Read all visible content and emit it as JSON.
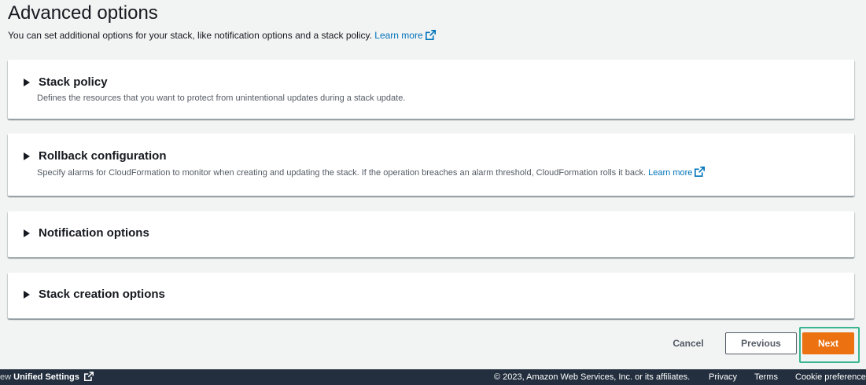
{
  "header": {
    "title": "Advanced options",
    "description": "You can set additional options for your stack, like notification options and a stack policy.",
    "learn_more": "Learn more"
  },
  "panels": [
    {
      "title": "Stack policy",
      "description": "Defines the resources that you want to protect from unintentional updates during a stack update."
    },
    {
      "title": "Rollback configuration",
      "description": "Specify alarms for CloudFormation to monitor when creating and updating the stack. If the operation breaches an alarm threshold, CloudFormation rolls it back.",
      "learn_more": "Learn more"
    },
    {
      "title": "Notification options"
    },
    {
      "title": "Stack creation options"
    }
  ],
  "actions": {
    "cancel": "Cancel",
    "previous": "Previous",
    "next": "Next"
  },
  "footer": {
    "left_prefix": "ew",
    "unified_settings": "Unified Settings",
    "copyright": "© 2023, Amazon Web Services, Inc. or its affiliates.",
    "privacy": "Privacy",
    "terms": "Terms",
    "cookie": "Cookie preferences"
  },
  "colors": {
    "link": "#0073bb",
    "primary": "#ec7211",
    "highlight": "#3bb58f",
    "footer_bg": "#232f3e",
    "page_bg": "#f2f3f3"
  }
}
